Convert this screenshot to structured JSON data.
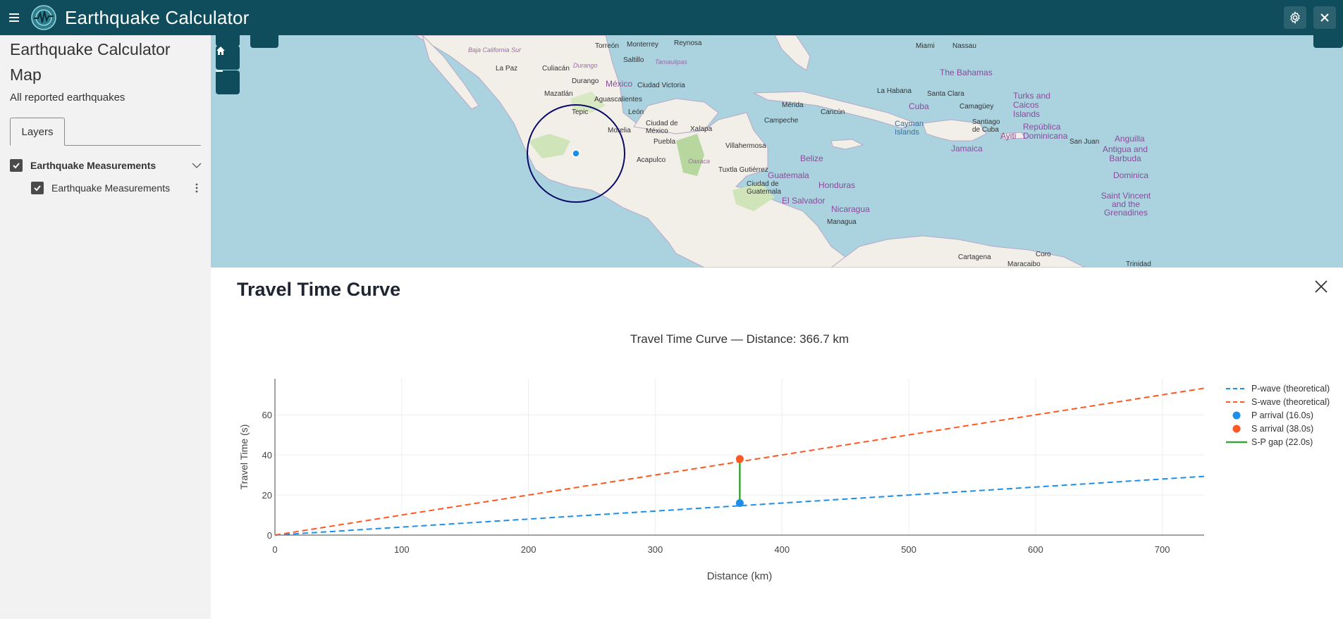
{
  "header": {
    "title": "Earthquake Calculator",
    "menu_icon": "hamburger-icon",
    "settings_icon": "gear-icon",
    "close_icon": "close-icon",
    "bg_color": "#0f4d5c"
  },
  "sidebar": {
    "title": "Earthquake Calculator Map",
    "subtitle": "All reported earthquakes",
    "tabs": [
      {
        "label": "Layers"
      }
    ],
    "layers": [
      {
        "label": "Earthquake Measurements",
        "checked": true,
        "expanded": true,
        "children": [
          {
            "label": "Earthquake Measurements",
            "checked": true
          }
        ]
      }
    ]
  },
  "map": {
    "places": {
      "torreon": "Torreón",
      "monterrey": "Monterrey",
      "reynosa": "Reynosa",
      "saltillo": "Saltillo",
      "tamaulipas": "Tamaulipas",
      "baja": "Baja California Sur",
      "lapaz": "La Paz",
      "culiacan": "Culiacán",
      "durango_st": "Durango",
      "durango": "Durango",
      "mazatlan": "Mazatlán",
      "mexico": "México",
      "cdvictoria": "Ciudad Victoria",
      "aguascalientes": "Aguascalientes",
      "tepic": "Tepic",
      "leon": "León",
      "cdmexico": "Ciudad de México",
      "morelia": "Morelia",
      "puebla": "Puebla",
      "xalapa": "Xalapa",
      "acapulco": "Acapulco",
      "oaxaca": "Oaxaca",
      "villahermosa": "Villahermosa",
      "tuxtla": "Tuxtla Gutiérrez",
      "merida": "Mérida",
      "campeche": "Campeche",
      "cancun": "Cancún",
      "belize": "Belize",
      "guatemala": "Guatemala",
      "cdguatemala": "Ciudad de Guatemala",
      "elsalvador": "El Salvador",
      "honduras": "Honduras",
      "nicaragua": "Nicaragua",
      "managua": "Managua",
      "cayman": "Cayman Islands",
      "miami": "Miami",
      "nassau": "Nassau",
      "bahamas": "The Bahamas",
      "lahabana": "La Habana",
      "santaclara": "Santa Clara",
      "cuba": "Cuba",
      "camaguey": "Camagüey",
      "santiago": "Santiago de Cuba",
      "turks": "Turks and Caicos Islands",
      "jamaica": "Jamaica",
      "ayiti": "Ayiti",
      "repdom": "República Dominicana",
      "sanjuan": "San Juan",
      "anguilla": "Anguilla",
      "antigua": "Antigua and Barbuda",
      "dominica": "Dominica",
      "stvincent": "Saint Vincent and the Grenadines",
      "cartagena": "Cartagena",
      "coro": "Coro",
      "maracaibo": "Maracaibo",
      "trinidad": "Trinidad"
    },
    "controls": {
      "home_icon": "home-icon",
      "zoom_out_icon": "minus-icon"
    }
  },
  "panel": {
    "title": "Travel Time Curve",
    "close_icon": "close-icon"
  },
  "chart_data": {
    "type": "line",
    "title": "Travel Time Curve — Distance: 366.7 km",
    "xlabel": "Distance (km)",
    "ylabel": "Travel Time (s)",
    "xlim": [
      0,
      733
    ],
    "ylim": [
      0,
      78
    ],
    "xticks": [
      0,
      100,
      200,
      300,
      400,
      500,
      600,
      700
    ],
    "yticks": [
      0,
      20,
      40,
      60
    ],
    "grid": true,
    "legend_position": "right",
    "series": [
      {
        "name": "P-wave (theoretical)",
        "kind": "dashed-line",
        "color": "#1f8ee8",
        "x": [
          0,
          733
        ],
        "y": [
          0,
          29.3
        ]
      },
      {
        "name": "S-wave (theoretical)",
        "kind": "dashed-line",
        "color": "#ff5722",
        "x": [
          0,
          733
        ],
        "y": [
          0,
          73.3
        ]
      },
      {
        "name": "P arrival (16.0s)",
        "kind": "marker",
        "color": "#1f8ee8",
        "x": [
          366.7
        ],
        "y": [
          16.0
        ]
      },
      {
        "name": "S arrival (38.0s)",
        "kind": "marker",
        "color": "#ff5722",
        "x": [
          366.7
        ],
        "y": [
          38.0
        ]
      },
      {
        "name": "S-P gap (22.0s)",
        "kind": "solid-line",
        "color": "#3aa63a",
        "x": [
          366.7,
          366.7
        ],
        "y": [
          16.0,
          38.0
        ]
      }
    ]
  }
}
